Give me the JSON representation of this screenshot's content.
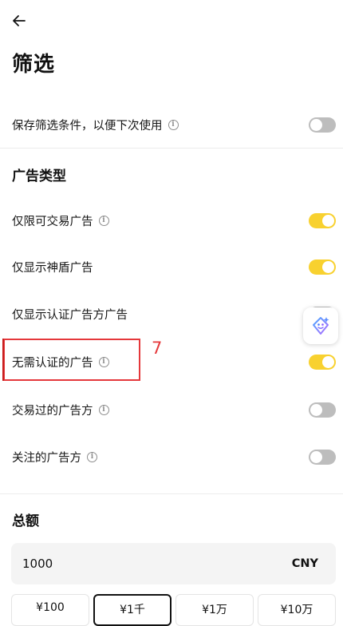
{
  "header": {
    "title": "筛选"
  },
  "save_filter": {
    "label": "保存筛选条件，以便下次使用",
    "on": false
  },
  "ad_type": {
    "section_title": "广告类型",
    "options": [
      {
        "label": "仅限可交易广告",
        "has_info": true,
        "on": true
      },
      {
        "label": "仅显示神盾广告",
        "has_info": false,
        "on": true
      },
      {
        "label": "仅显示认证广告方广告",
        "has_info": false,
        "on": false
      },
      {
        "label": "无需认证的广告",
        "has_info": true,
        "on": true
      },
      {
        "label": "交易过的广告方",
        "has_info": true,
        "on": false
      },
      {
        "label": "关注的广告方",
        "has_info": true,
        "on": false
      }
    ]
  },
  "annotation": {
    "number": "7",
    "color": "#e5383b"
  },
  "amount": {
    "section_title": "总额",
    "value": "1000",
    "currency": "CNY",
    "chips": [
      {
        "label": "¥100",
        "selected": false
      },
      {
        "label": "¥1千",
        "selected": true
      },
      {
        "label": "¥1万",
        "selected": false
      },
      {
        "label": "¥10万",
        "selected": false
      }
    ]
  },
  "colors": {
    "toggle_on": "#f8d12f",
    "toggle_off": "#bdbdbd"
  },
  "icons": {
    "back": "arrow-left-icon",
    "info": "info-circle-icon",
    "floating_assistant": "sparkle-face-icon"
  }
}
